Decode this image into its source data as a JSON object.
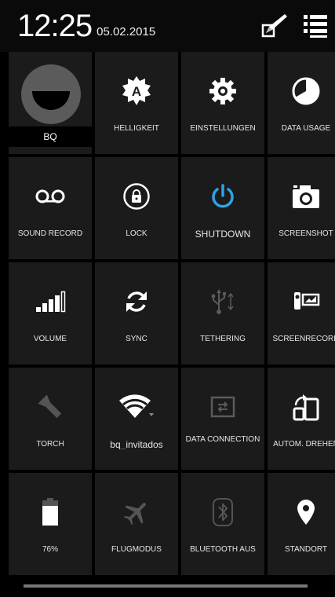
{
  "header": {
    "time": "12:25",
    "date": "05.02.2015",
    "edit_icon": "edit-pencil-icon",
    "list_icon": "settings-list-icon"
  },
  "tiles": [
    {
      "id": "profile",
      "label": "BQ",
      "icon": "avatar"
    },
    {
      "id": "brightness",
      "label": "HELLIGKEIT",
      "icon": "auto-brightness-icon"
    },
    {
      "id": "settings",
      "label": "EINSTELLUNGEN",
      "icon": "gear-icon"
    },
    {
      "id": "data-usage",
      "label": "DATA USAGE",
      "icon": "data-usage-icon"
    },
    {
      "id": "sound-record",
      "label": "SOUND RECORD",
      "icon": "voicemail-icon"
    },
    {
      "id": "lock",
      "label": "LOCK",
      "icon": "lock-icon"
    },
    {
      "id": "shutdown",
      "label": "SHUTDOWN",
      "icon": "power-icon"
    },
    {
      "id": "screenshot",
      "label": "SCREENSHOT",
      "icon": "camera-icon"
    },
    {
      "id": "volume",
      "label": "VOLUME",
      "icon": "volume-bars-icon"
    },
    {
      "id": "sync",
      "label": "SYNC",
      "icon": "sync-icon"
    },
    {
      "id": "tethering",
      "label": "TETHERING",
      "icon": "usb-icon"
    },
    {
      "id": "screenrecord",
      "label": "SCREENRECORD",
      "icon": "camcorder-icon"
    },
    {
      "id": "torch",
      "label": "TORCH",
      "icon": "flashlight-icon"
    },
    {
      "id": "wifi",
      "label": "bq_invitados",
      "icon": "wifi-icon"
    },
    {
      "id": "data-connection",
      "label": "DATA CONNECTION",
      "icon": "data-connection-icon"
    },
    {
      "id": "auto-rotate",
      "label": "AUTOM. DREHEN",
      "icon": "rotate-icon"
    },
    {
      "id": "battery",
      "label": "76%",
      "icon": "battery-icon"
    },
    {
      "id": "airplane",
      "label": "FLUGMODUS",
      "icon": "airplane-icon"
    },
    {
      "id": "bluetooth",
      "label": "BLUETOOTH AUS",
      "icon": "bluetooth-icon"
    },
    {
      "id": "location",
      "label": "STANDORT",
      "icon": "location-icon"
    }
  ],
  "battery_level": 76,
  "colors": {
    "accent": "#2ea3e6",
    "tile_bg": "#1b1b1b",
    "disabled": "#5a5a5a"
  }
}
